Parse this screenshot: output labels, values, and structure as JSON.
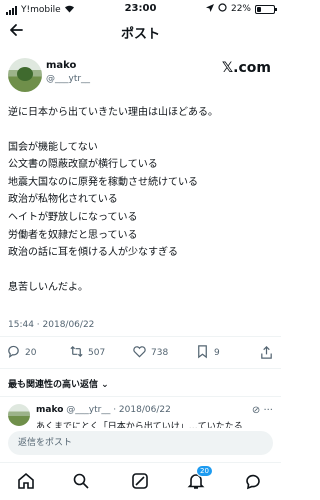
{
  "status_bar": {
    "carrier": "Y!mobile",
    "time": "23:00",
    "battery": "22%"
  },
  "header": {
    "back_icon": "arrow-left-icon",
    "title": "ポスト"
  },
  "author": {
    "name": "mako",
    "handle": "@___ytr__",
    "logo": "𝕏.com"
  },
  "tweet": {
    "intro": "逆に日本から出ていきたい理由は山ほどある。",
    "lines": [
      "国会が機能してない",
      "公文書の隠蔽改竄が横行している",
      "地震大国なのに原発を稼動させ続けている",
      "政治が私物化されている",
      "ヘイトが野放しになっている",
      "労働者を奴隷だと思っている",
      "政治の話に耳を傾ける人が少なすぎる"
    ],
    "closing": "息苦しいんだよ。",
    "timestamp": "15:44 · 2018/06/22"
  },
  "actions": {
    "replies": "20",
    "retweets": "507",
    "likes": "738",
    "bookmarks": "9"
  },
  "replies_header": "最も関連性の高い返信 ⌄",
  "reply_preview": {
    "name": "mako",
    "handle": "@___ytr__",
    "date": "· 2018/06/22",
    "text": "あくまでにとく「日本から出ていけ」…ていたたる"
  },
  "composer": {
    "placeholder": "返信をポスト"
  },
  "tabbar": {
    "notifications_badge": "20"
  }
}
